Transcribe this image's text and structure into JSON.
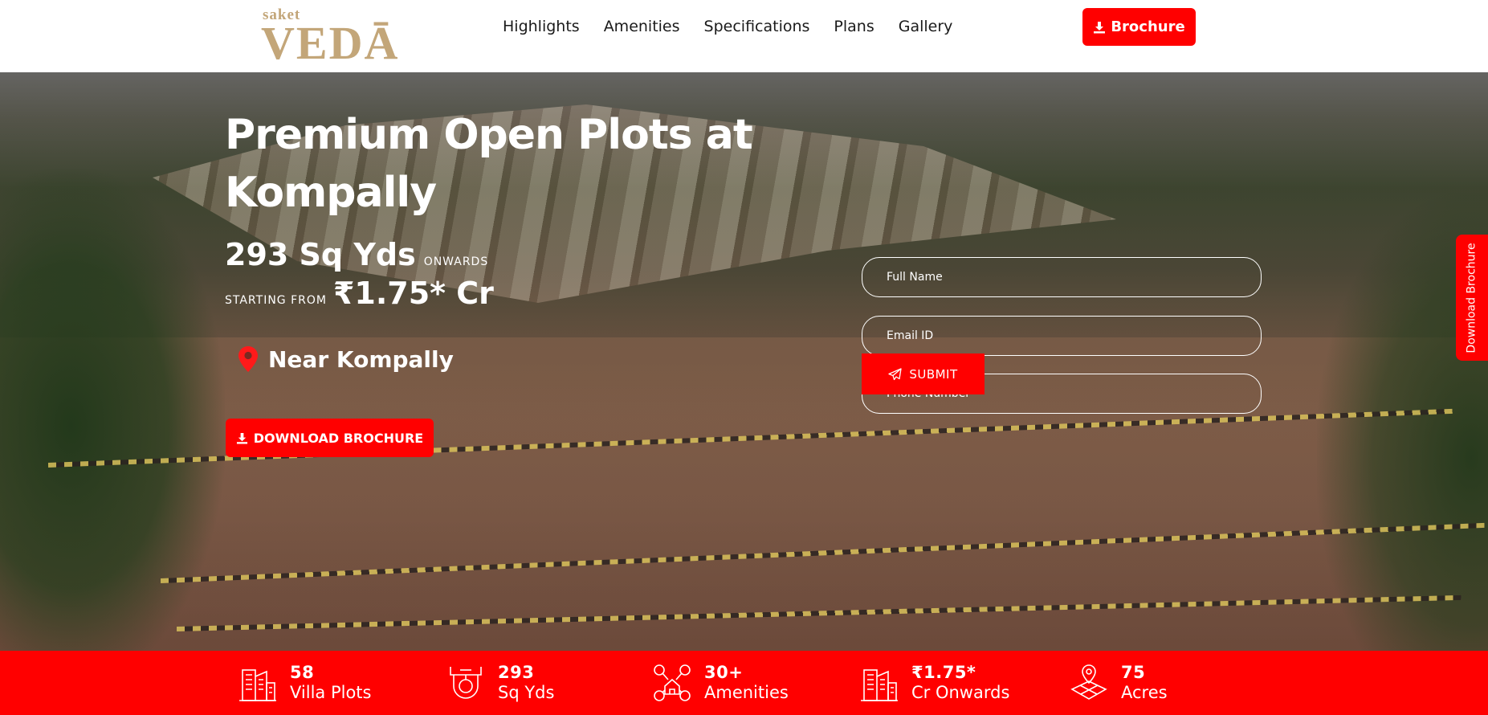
{
  "logo": {
    "small": "saket",
    "big": "VEDĀ"
  },
  "nav": {
    "items": [
      "Highlights",
      "Amenities",
      "Specifications",
      "Plans",
      "Gallery"
    ]
  },
  "header": {
    "brochure_label": "Brochure"
  },
  "hero": {
    "title_line1": "Premium Open Plots at",
    "title_line2": "Kompally",
    "size_value": "293 Sq Yds",
    "size_suffix": "ONWARDS",
    "price_prefix": "STARTING FROM",
    "price_value": "₹1.75* Cr",
    "location": "Near Kompally",
    "download_label": "DOWNLOAD BROCHURE"
  },
  "form": {
    "name_placeholder": "Full Name",
    "email_placeholder": "Email ID",
    "phone_placeholder": "Phone Number*",
    "submit_label": "SUBMIT"
  },
  "side_tab": {
    "label": "Download Brochure"
  },
  "stats": [
    {
      "value": "58",
      "label": "Villa Plots",
      "icon": "building-icon"
    },
    {
      "value": "293",
      "label": "Sq Yds",
      "icon": "plot-size-icon"
    },
    {
      "value": "30+",
      "label": "Amenities",
      "icon": "amenities-icon"
    },
    {
      "value": "₹1.75*",
      "label": "Cr Onwards",
      "icon": "price-building-icon"
    },
    {
      "value": "75",
      "label": "Acres",
      "icon": "map-pin-icon"
    }
  ],
  "colors": {
    "accent": "#ff0000",
    "logo_gold": "#c3a679",
    "text": "#1a1a1a"
  }
}
